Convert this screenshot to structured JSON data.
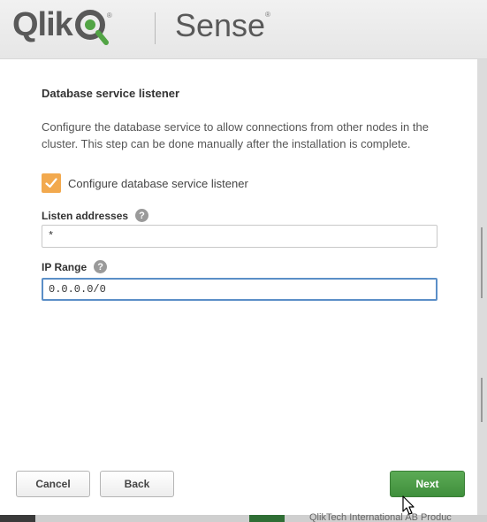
{
  "header": {
    "logo_text": "Qlik",
    "registered_mark": "®",
    "product_name": "Sense",
    "brand_green": "#52a445"
  },
  "section": {
    "title": "Database service listener",
    "description": "Configure the database service to allow connections from other nodes in the cluster. This step can be done manually after the installation is complete."
  },
  "checkbox": {
    "label": "Configure database service listener",
    "checked": true,
    "color": "#f2a94e"
  },
  "listen_addresses": {
    "label": "Listen addresses",
    "value": "*",
    "help_icon": "help-circle-icon"
  },
  "ip_range": {
    "label": "IP Range",
    "value": "0.0.0.0/0",
    "help_icon": "help-circle-icon"
  },
  "buttons": {
    "cancel": "Cancel",
    "back": "Back",
    "next": "Next",
    "next_color": "#4b9b46"
  },
  "footer": {
    "partial_text": "QlikTech International AB Produc"
  }
}
